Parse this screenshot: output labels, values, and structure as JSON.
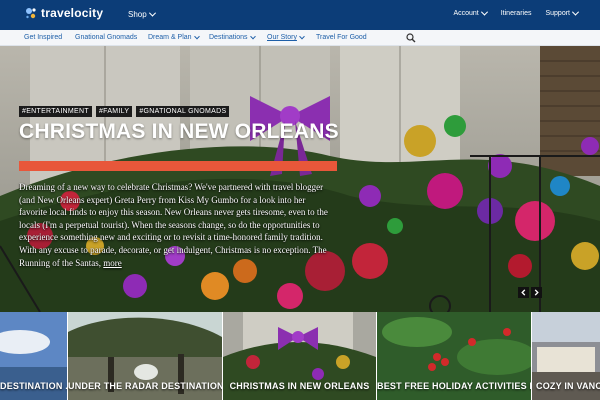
{
  "brand": {
    "name": "travelocity",
    "color": "#0c3d78",
    "accent": "#e8573a"
  },
  "topbar": {
    "shop_label": "Shop",
    "right": [
      {
        "label": "Account",
        "has_dropdown": true
      },
      {
        "label": "Itineraries",
        "has_dropdown": false
      },
      {
        "label": "Support",
        "has_dropdown": true
      }
    ]
  },
  "subnav": {
    "items": [
      {
        "label": "Get Inspired",
        "has_dropdown": false
      },
      {
        "label": "Gnational Gnomads",
        "has_dropdown": false
      },
      {
        "label": "Dream & Plan",
        "has_dropdown": true
      },
      {
        "label": "Destinations",
        "has_dropdown": true
      },
      {
        "label": "Our Story",
        "has_dropdown": true
      },
      {
        "label": "Travel For Good",
        "has_dropdown": false
      }
    ],
    "search_icon": "search-icon"
  },
  "hero": {
    "tags": [
      "#ENTERTAINMENT",
      "#FAMILY",
      "#GNATIONAL GNOMADS"
    ],
    "title": "CHRISTMAS IN NEW ORLEANS",
    "excerpt": "Dreaming of a new way to celebrate Christmas? We've partnered with travel blogger (and New Orleans expert) Greta Perry from Kiss My Gumbo for a look into her favorite local finds to enjoy this season.  New Orleans never gets tiresome, even to the locals (I'm a perpetual tourist). When the seasons change, so do the opportunities to experience something new and exciting or to revisit a time-honored family tradition. With any excuse to parade, decorate, or get indulgent, Christmas is no exception. The Running of the Santas,",
    "more_label": "more",
    "prev_icon": "chevron-left-icon",
    "next_icon": "chevron-right-icon"
  },
  "thumbnails": [
    {
      "title": "DESTINATION ..."
    },
    {
      "title": "UNDER THE RADAR DESTINATION ..."
    },
    {
      "title": "CHRISTMAS IN NEW ORLEANS"
    },
    {
      "title": "BEST FREE HOLIDAY ACTIVITIES I..."
    },
    {
      "title": "COZY IN VANCOU"
    }
  ]
}
